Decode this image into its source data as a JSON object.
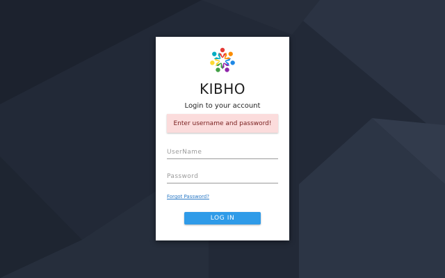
{
  "brand": {
    "name": "KIBHO",
    "logo_icon": "kibho-star-people-icon"
  },
  "login": {
    "subtitle": "Login to your account",
    "error_message": "Enter username and password!",
    "username_placeholder": "UserName",
    "username_value": "",
    "password_placeholder": "Password",
    "password_value": "",
    "forgot_label": "Forgot Password?",
    "submit_label": "LOG IN"
  },
  "colors": {
    "background": "#232a38",
    "card": "#ffffff",
    "alert_bg": "#fbdcdc",
    "alert_text": "#7a2020",
    "primary_button": "#2f9be8",
    "link": "#2a79c6"
  }
}
